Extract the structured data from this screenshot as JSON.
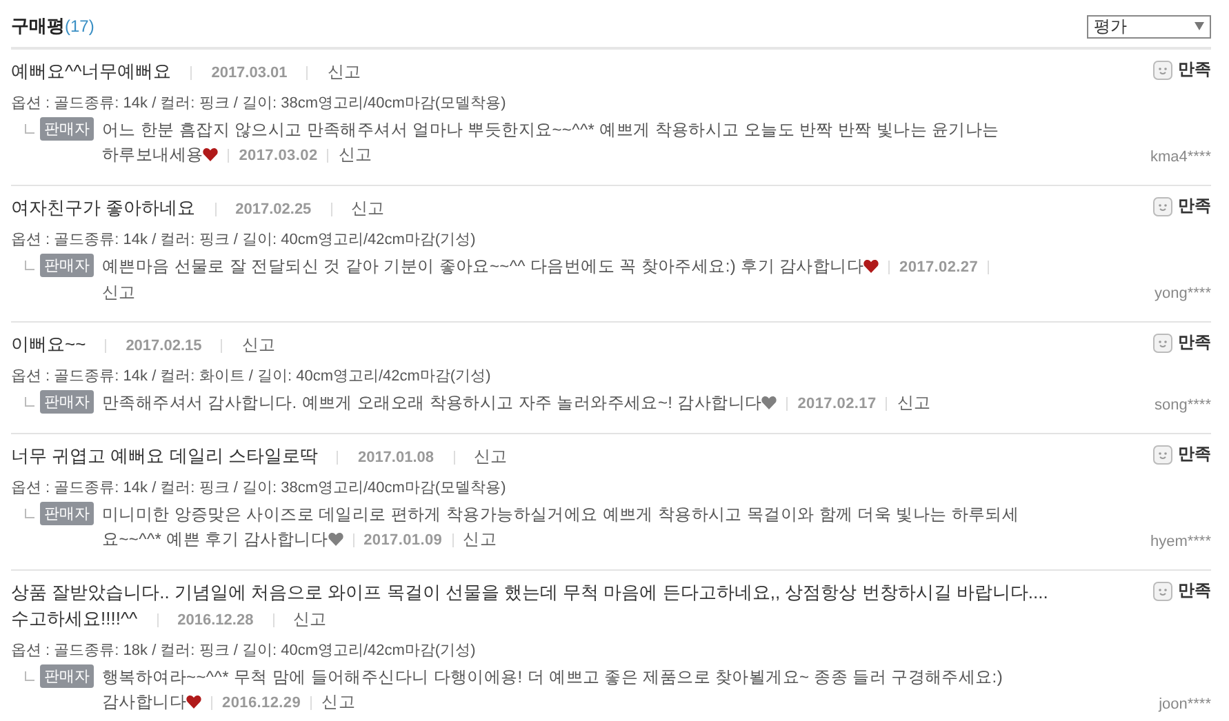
{
  "header": {
    "title": "구매평",
    "count": "(17)",
    "sort": {
      "value": "평가"
    }
  },
  "reviews": [
    {
      "title": [
        "예뻐요^^너무예뻐요"
      ],
      "date": "2017.03.01",
      "report": "신고",
      "option": "옵션 : 골드종류: 14k / 컬러: 핑크 / 길이: 38cm영고리/40cm마감(모델착용)",
      "rating": "만족",
      "user": "kma4****",
      "reply": {
        "badge": "판매자",
        "lines": [
          "어느 한분 흠잡지 않으시고 만족해주셔서 얼마나 뿌듯한지요~~^^* 예쁘게 착용하시고 오늘도 반짝 반짝 빛나는 윤기나는",
          "하루보내세용"
        ],
        "color": "#b01a1a",
        "date": "2017.03.02",
        "report": "신고"
      }
    },
    {
      "title": [
        "여자친구가 좋아하네요"
      ],
      "date": "2017.02.25",
      "report": "신고",
      "option": "옵션 : 골드종류: 14k / 컬러: 핑크 / 길이: 40cm영고리/42cm마감(기성)",
      "rating": "만족",
      "user": "yong****",
      "reply": {
        "badge": "판매자",
        "lines": [
          "예쁜마음 선물로 잘 전달되신 것 같아 기분이 좋아요~~^^ 다음번에도 꼭 찾아주세요:) 후기 감사합니다"
        ],
        "color": "#b01a1a",
        "date": "2017.02.27",
        "report": "신고"
      }
    },
    {
      "title": [
        "이뻐요~~"
      ],
      "date": "2017.02.15",
      "report": "신고",
      "option": "옵션 : 골드종류: 14k / 컬러: 화이트 / 길이: 40cm영고리/42cm마감(기성)",
      "rating": "만족",
      "user": "song****",
      "reply": {
        "badge": "판매자",
        "lines": [
          "만족해주셔서 감사합니다. 예쁘게 오래오래 착용하시고 자주 놀러와주세요~! 감사합니다"
        ],
        "color": "#808080",
        "date": "2017.02.17",
        "report": "신고"
      }
    },
    {
      "title": [
        "너무 귀엽고 예뻐요 데일리 스타일로딱"
      ],
      "date": "2017.01.08",
      "report": "신고",
      "option": "옵션 : 골드종류: 14k / 컬러: 핑크 / 길이: 38cm영고리/40cm마감(모델착용)",
      "rating": "만족",
      "user": "hyem****",
      "reply": {
        "badge": "판매자",
        "lines": [
          "미니미한 앙증맞은 사이즈로 데일리로 편하게 착용가능하실거에요 예쁘게 착용하시고 목걸이와 함께 더욱 빛나는 하루되세",
          "요~~^^* 예쁜 후기 감사합니다"
        ],
        "color": "#808080",
        "date": "2017.01.09",
        "report": "신고"
      }
    },
    {
      "title": [
        "상품 잘받았습니다.. 기념일에 처음으로 와이프 목걸이 선물을 했는데 무척 마음에 든다고하네요,, 상점항상 번창하시길 바랍니다....",
        "수고하세요!!!!^^"
      ],
      "date": "2016.12.28",
      "report": "신고",
      "option": "옵션 : 골드종류: 18k / 컬러: 핑크 / 길이: 40cm영고리/42cm마감(기성)",
      "rating": "만족",
      "user": "joon****",
      "reply": {
        "badge": "판매자",
        "lines": [
          "행복하여라~~^^* 무척 맘에 들어해주신다니 다행이에용! 더 예쁘고 좋은 제품으로 찾아뵐게요~ 종종 들러 구경해주세요:)",
          "감사합니다"
        ],
        "color": "#b01a1a",
        "date": "2016.12.29",
        "report": "신고"
      }
    }
  ]
}
